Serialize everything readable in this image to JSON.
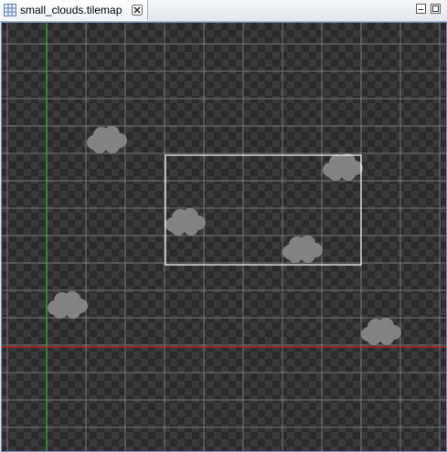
{
  "editor_tab": {
    "title": "small_clouds.tilemap",
    "icon": "tilemap-grid-icon",
    "close_icon": "close-icon"
  },
  "window_controls": [
    "minimize-icon",
    "maximize-icon"
  ],
  "tilemap": {
    "grid_color": "#8c8c8c",
    "x_axis_color": "#d21c1c",
    "y_axis_color": "#27c22a",
    "selection_color": "#ffffff",
    "cloud_color": "#8a8a8a",
    "clouds": [
      "cloud",
      "cloud",
      "cloud",
      "cloud",
      "cloud",
      "cloud"
    ]
  }
}
